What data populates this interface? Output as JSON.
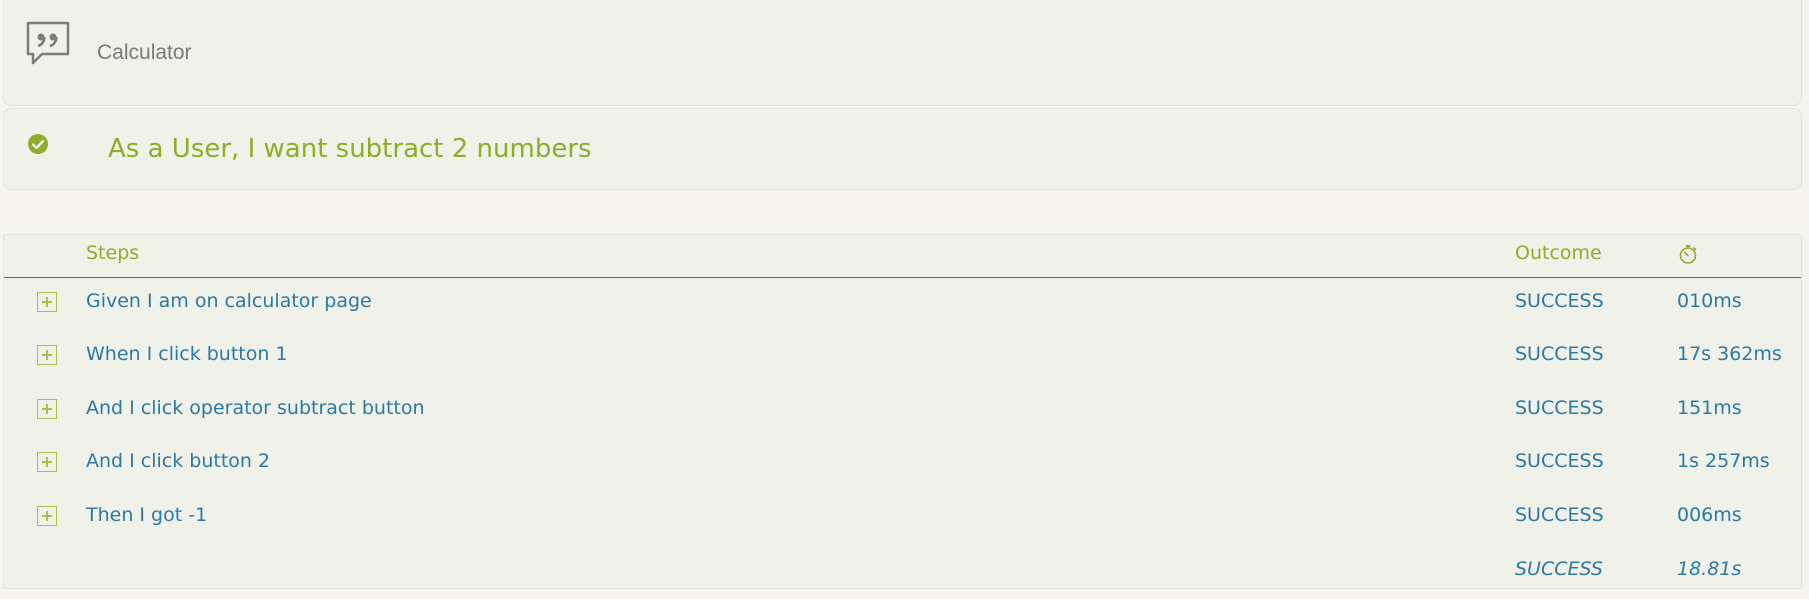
{
  "story": {
    "title": "Calculator",
    "icon": "quote-icon"
  },
  "scenario": {
    "title": "As a User, I want subtract 2 numbers",
    "status_icon": "check-circle-icon",
    "status_color": "#8fac2a"
  },
  "table": {
    "headers": {
      "steps": "Steps",
      "outcome": "Outcome",
      "duration_icon": "stopwatch-icon"
    },
    "rows": [
      {
        "step": "Given I am on calculator page",
        "outcome": "SUCCESS",
        "duration": "010ms"
      },
      {
        "step": "When I click button 1",
        "outcome": "SUCCESS",
        "duration": "17s 362ms"
      },
      {
        "step": "And I click operator subtract button",
        "outcome": "SUCCESS",
        "duration": "151ms"
      },
      {
        "step": "And I click button 2",
        "outcome": "SUCCESS",
        "duration": "1s 257ms"
      },
      {
        "step": "Then I got -1",
        "outcome": "SUCCESS",
        "duration": "006ms"
      }
    ],
    "total": {
      "outcome": "SUCCESS",
      "duration": "18.81s"
    }
  },
  "colors": {
    "accent_green": "#8fac2a",
    "link_blue": "#2a7aa6",
    "card_bg": "#f0f1e8"
  }
}
